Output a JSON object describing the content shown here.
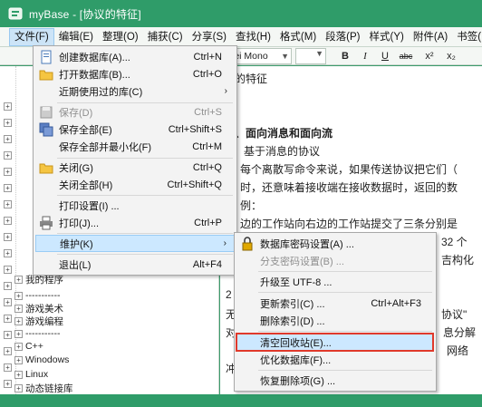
{
  "window": {
    "title": "myBase - [协议的特征]"
  },
  "menubar": [
    {
      "label": "文件(F)",
      "active": true
    },
    {
      "label": "编辑(E)"
    },
    {
      "label": "整理(O)"
    },
    {
      "label": "捕获(C)"
    },
    {
      "label": "分享(S)"
    },
    {
      "label": "查找(H)"
    },
    {
      "label": "格式(M)"
    },
    {
      "label": "段落(P)"
    },
    {
      "label": "样式(Y)"
    },
    {
      "label": "附件(A)"
    },
    {
      "label": "书签("
    }
  ],
  "toolbar": {
    "font_value": "lei Mono",
    "bold": "B",
    "italic": "I",
    "underline": "U",
    "strike": "abc",
    "super": "x²",
    "sub": "x₂"
  },
  "tree": {
    "items": [
      {
        "label": "我的程序"
      },
      {
        "label": "-----------"
      },
      {
        "label": "游戏美术"
      },
      {
        "label": "游戏编程"
      },
      {
        "label": "-----------"
      },
      {
        "label": "C++"
      },
      {
        "label": "Winodows"
      },
      {
        "label": "Linux"
      },
      {
        "label": "动态链接库"
      }
    ]
  },
  "editor": {
    "lines": [
      "议的特征",
      "、面向消息和面向流",
      "基于消息的协议",
      "每个离散写命令来说，如果传送协议把它们（",
      "时，还意味着接收端在接收数据时，返回的数",
      "例：",
      "边的工作站向右边的工作站提交了三条分别是",
      "32 个",
      "吉构化",
      "2",
      "无",
      "协议\"",
      "对",
      "息分解",
      "网络",
      "冲"
    ]
  },
  "file_menu": {
    "items": [
      {
        "label": "创建数据库(A)...",
        "shortcut": "Ctrl+N",
        "icon": "new-database-icon"
      },
      {
        "label": "打开数据库(B)...",
        "shortcut": "Ctrl+O",
        "icon": "open-folder-icon"
      },
      {
        "label": "近期使用过的库(C)",
        "shortcut": "",
        "submenu": true
      },
      {
        "label": "保存(D)",
        "shortcut": "Ctrl+S",
        "icon": "save-icon",
        "disabled": true
      },
      {
        "label": "保存全部(E)",
        "shortcut": "Ctrl+Shift+S",
        "icon": "save-all-icon"
      },
      {
        "label": "保存全部并最小化(F)",
        "shortcut": "Ctrl+M"
      },
      {
        "label": "关闭(G)",
        "shortcut": "Ctrl+Q",
        "icon": "close-folder-icon"
      },
      {
        "label": "关闭全部(H)",
        "shortcut": "Ctrl+Shift+Q"
      },
      {
        "label": "打印设置(I) ...",
        "shortcut": ""
      },
      {
        "label": "打印(J)...",
        "shortcut": "Ctrl+P",
        "icon": "print-icon"
      },
      {
        "label": "维护(K)",
        "shortcut": "",
        "submenu": true,
        "hover": true
      },
      {
        "label": "退出(L)",
        "shortcut": "Alt+F4"
      }
    ]
  },
  "maintenance_menu": {
    "items": [
      {
        "label": "数据库密码设置(A) ...",
        "shortcut": "",
        "icon": "lock-icon"
      },
      {
        "label": "分支密码设置(B) ...",
        "shortcut": "",
        "disabled": true
      },
      {
        "label": "升级至 UTF-8 ...",
        "shortcut": ""
      },
      {
        "label": "更新索引(C) ...",
        "shortcut": "Ctrl+Alt+F3"
      },
      {
        "label": "删除索引(D) ...",
        "shortcut": ""
      },
      {
        "label": "清空回收站(E)...",
        "shortcut": "",
        "highlighted": true
      },
      {
        "label": "优化数据库(F)...",
        "shortcut": ""
      },
      {
        "label": "恢复删除项(G) ...",
        "shortcut": ""
      }
    ]
  },
  "colors": {
    "titlebar": "#2f9c69",
    "highlight_border": "#e0392b",
    "menu_hover": "#cce8ff"
  }
}
